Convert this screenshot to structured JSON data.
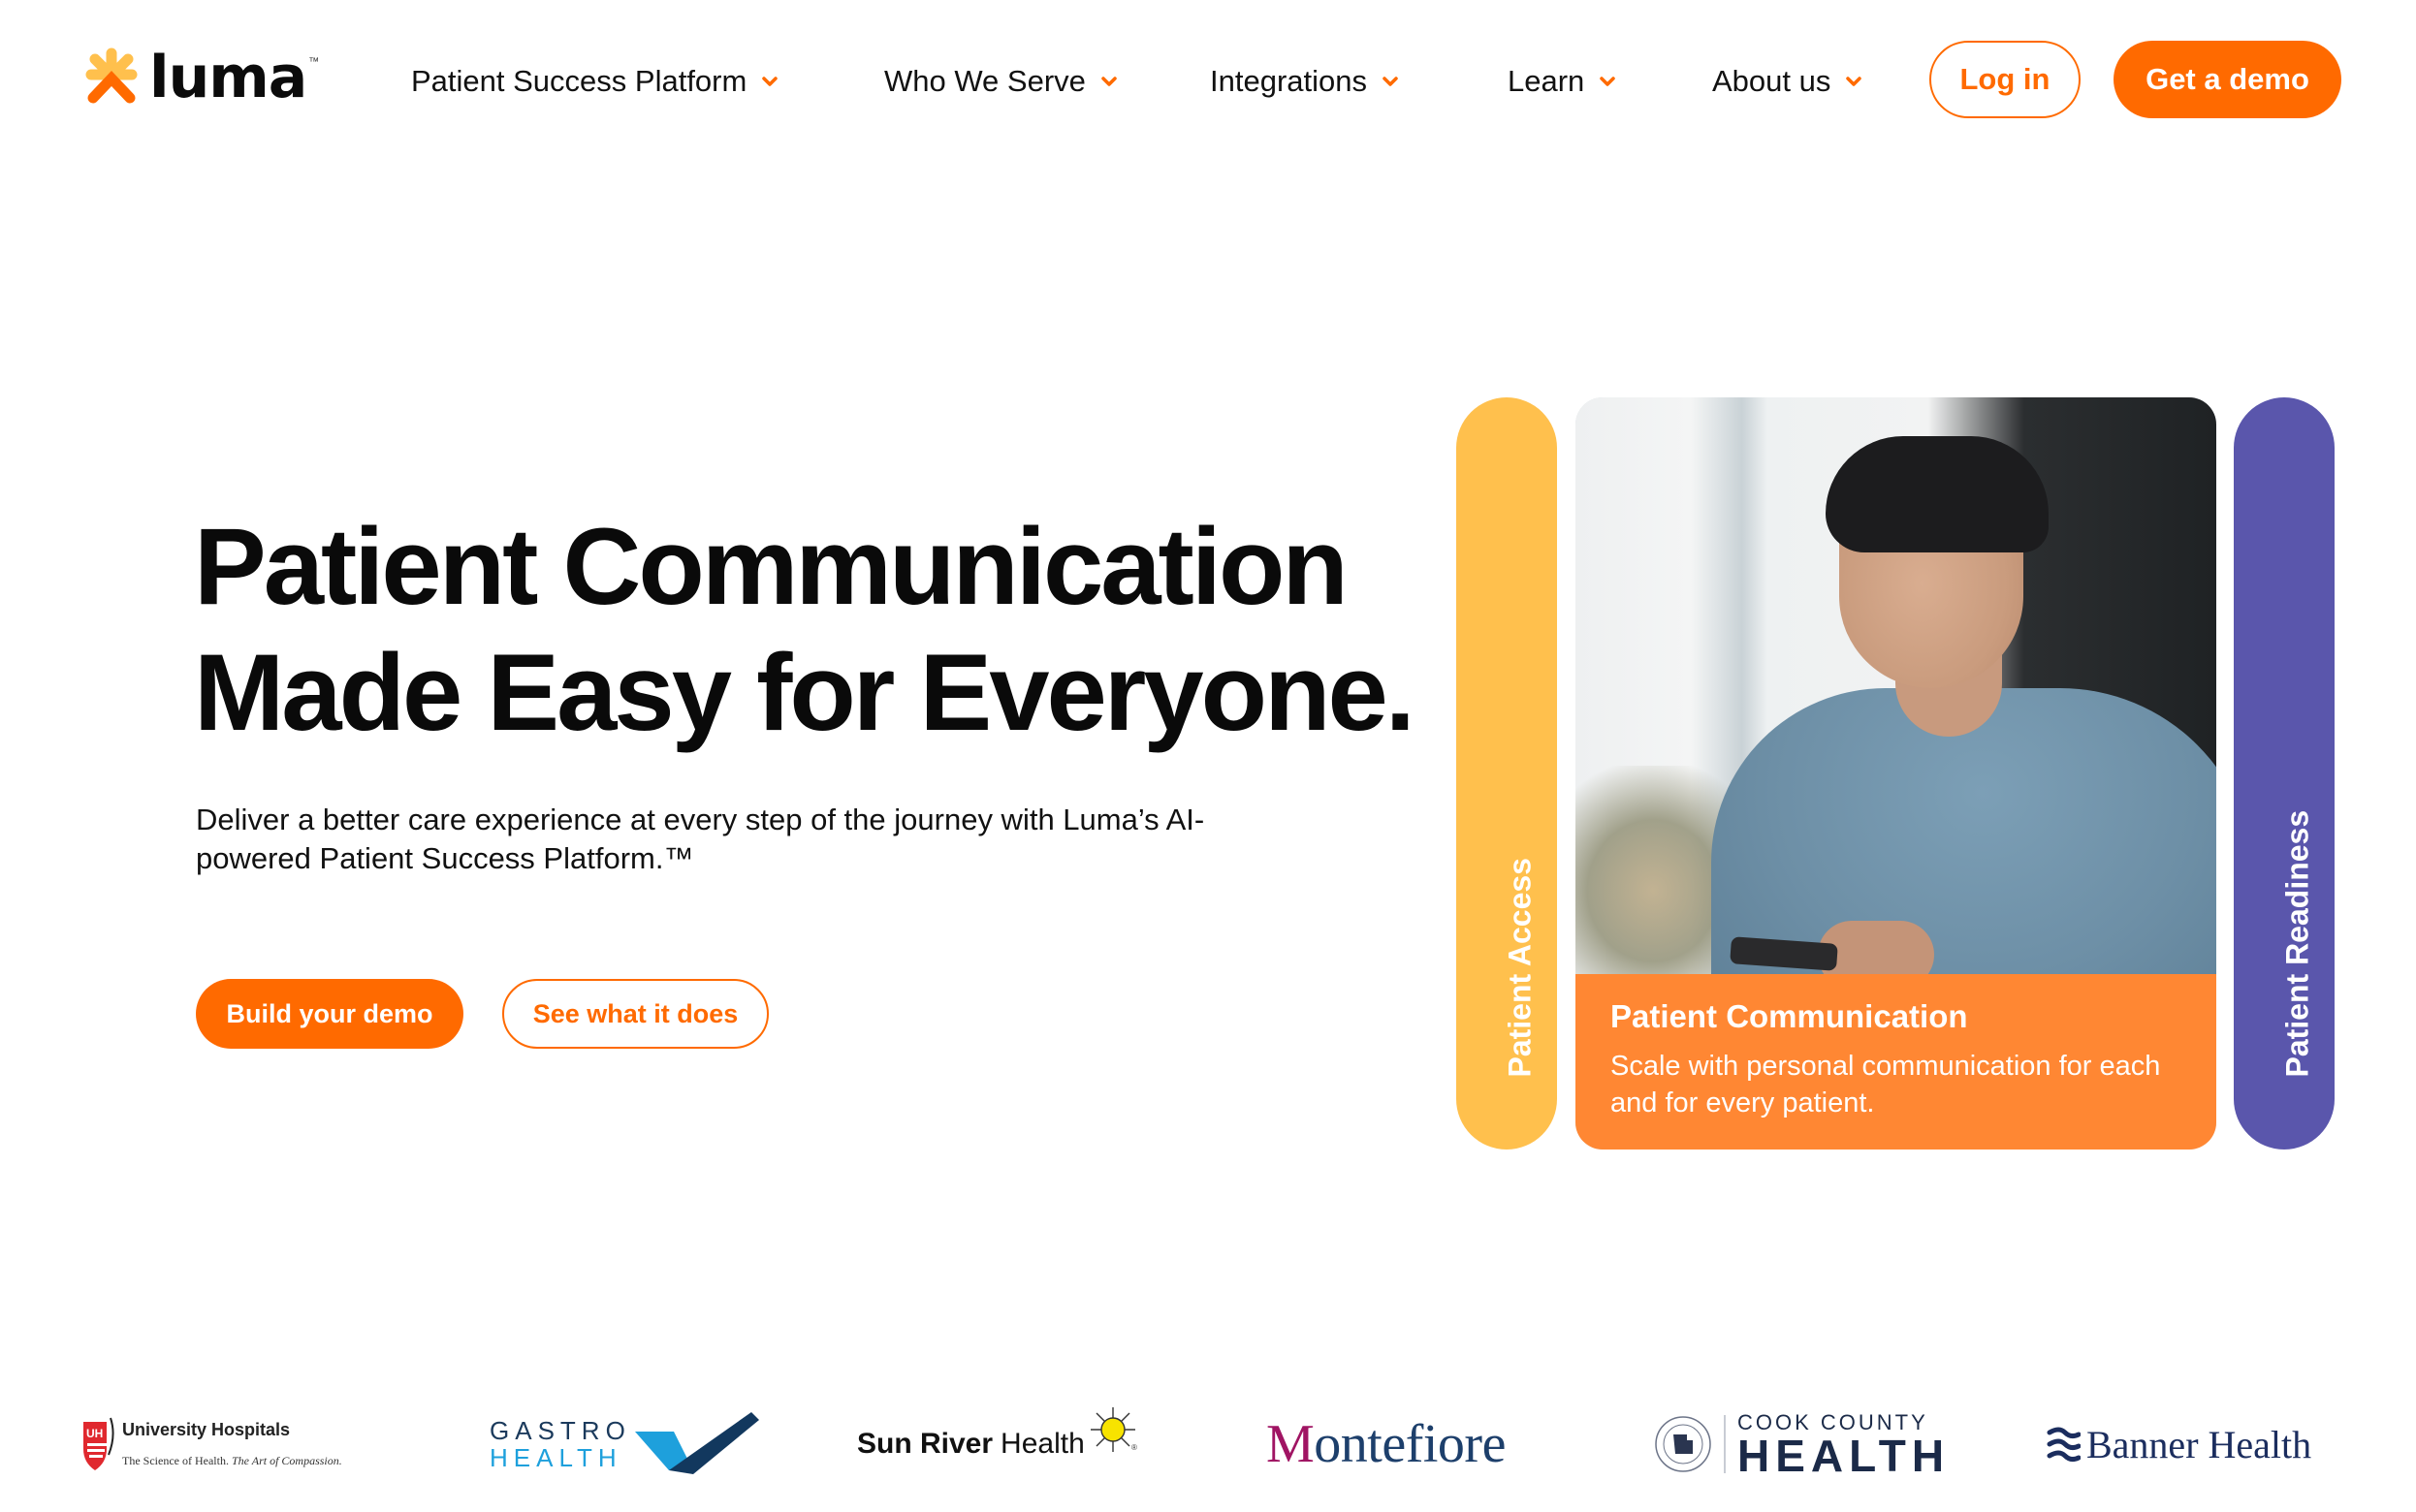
{
  "header": {
    "logo": {
      "text": "luma",
      "tm": "™",
      "icon": "luma-asterisk-icon"
    },
    "nav": [
      {
        "label": "Patient Success Platform",
        "icon": "chevron-down-icon"
      },
      {
        "label": "Who We Serve",
        "icon": "chevron-down-icon"
      },
      {
        "label": "Integrations",
        "icon": "chevron-down-icon"
      },
      {
        "label": "Learn",
        "icon": "chevron-down-icon"
      },
      {
        "label": "About us",
        "icon": "chevron-down-icon"
      }
    ],
    "login_label": "Log in",
    "demo_label": "Get a demo"
  },
  "hero": {
    "title_part1": "Patient ",
    "title_highlight": "Communication",
    "title_line2": "Made Easy for Everyone.",
    "subtitle": "Deliver a better care experience at every step of the journey with Luma’s AI-powered Patient Success Platform.™",
    "primary_cta": "Build your demo",
    "secondary_cta": "See what it does"
  },
  "cards": {
    "left_pill": "Patient Access",
    "right_pill": "Patient Readiness",
    "featured": {
      "title": "Patient Communication",
      "description": "Scale with personal communication for each and for every patient.",
      "image_alt": "man-looking-at-phone-photo"
    }
  },
  "customers": {
    "university_hospitals": {
      "name": "University Hospitals",
      "tagline_plain": "The Science of Health. ",
      "tagline_italic": "The Art of Compassion.",
      "mark": "UH"
    },
    "gastro_health": {
      "line1": "GASTRO",
      "line2": "HEALTH"
    },
    "sun_river": {
      "bold": "Sun River",
      "light": "Health",
      "reg": "®"
    },
    "montefiore": {
      "initial": "M",
      "rest": "ontefiore"
    },
    "cook_county": {
      "line1": "COOK COUNTY",
      "line2": "HEALTH"
    },
    "banner": {
      "name": "Banner Health",
      "reg": "."
    }
  },
  "colors": {
    "brand_orange": "#ff6a00",
    "panel_orange": "#ff8733",
    "highlight_orange": "#ffa066",
    "yellow": "#ffc04d",
    "purple": "#5a56ac"
  }
}
